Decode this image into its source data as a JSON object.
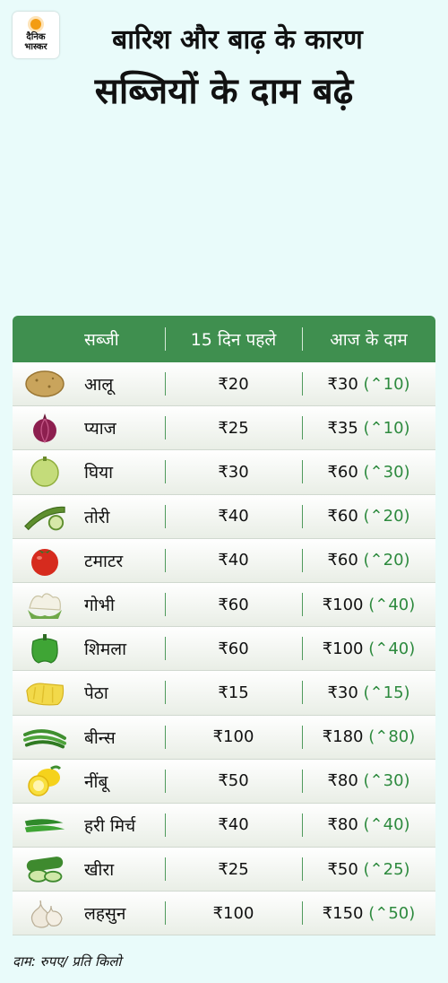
{
  "brand": {
    "line1": "दैनिक",
    "line2": "भास्कर"
  },
  "title": {
    "line1": "बारिश और बाढ़ के कारण",
    "line2": "सब्जियों के दाम बढ़े"
  },
  "table": {
    "headers": [
      "सब्जी",
      "15 दिन पहले",
      "आज के दाम"
    ],
    "rows": [
      {
        "icon": "potato-icon",
        "name": "आलू",
        "before": "₹20",
        "now": "₹30",
        "increase": "(⌃10)"
      },
      {
        "icon": "onion-icon",
        "name": "प्याज",
        "before": "₹25",
        "now": "₹35",
        "increase": "(⌃10)"
      },
      {
        "icon": "bottle-gourd-icon",
        "name": "घिया",
        "before": "₹30",
        "now": "₹60",
        "increase": "(⌃30)"
      },
      {
        "icon": "ridge-gourd-icon",
        "name": "तोरी",
        "before": "₹40",
        "now": "₹60",
        "increase": "(⌃20)"
      },
      {
        "icon": "tomato-icon",
        "name": "टमाटर",
        "before": "₹40",
        "now": "₹60",
        "increase": "(⌃20)"
      },
      {
        "icon": "cauliflower-icon",
        "name": "गोभी",
        "before": "₹60",
        "now": "₹100",
        "increase": "(⌃40)"
      },
      {
        "icon": "capsicum-icon",
        "name": "शिमला",
        "before": "₹60",
        "now": "₹100",
        "increase": "(⌃40)"
      },
      {
        "icon": "ash-gourd-icon",
        "name": "पेठा",
        "before": "₹15",
        "now": "₹30",
        "increase": "(⌃15)"
      },
      {
        "icon": "beans-icon",
        "name": "बीन्स",
        "before": "₹100",
        "now": "₹180",
        "increase": "(⌃80)"
      },
      {
        "icon": "lemon-icon",
        "name": "नींबू",
        "before": "₹50",
        "now": "₹80",
        "increase": "(⌃30)"
      },
      {
        "icon": "green-chilli-icon",
        "name": "हरी मिर्च",
        "before": "₹40",
        "now": "₹80",
        "increase": "(⌃40)"
      },
      {
        "icon": "cucumber-icon",
        "name": "खीरा",
        "before": "₹25",
        "now": "₹50",
        "increase": "(⌃25)"
      },
      {
        "icon": "garlic-icon",
        "name": "लहसुन",
        "before": "₹100",
        "now": "₹150",
        "increase": "(⌃50)"
      }
    ]
  },
  "footnote": "दाम: रुपए/ प्रति किलो",
  "colors": {
    "header": "#3f8f4f",
    "increase": "#2d8a3e",
    "background": "#e9fbfa"
  }
}
